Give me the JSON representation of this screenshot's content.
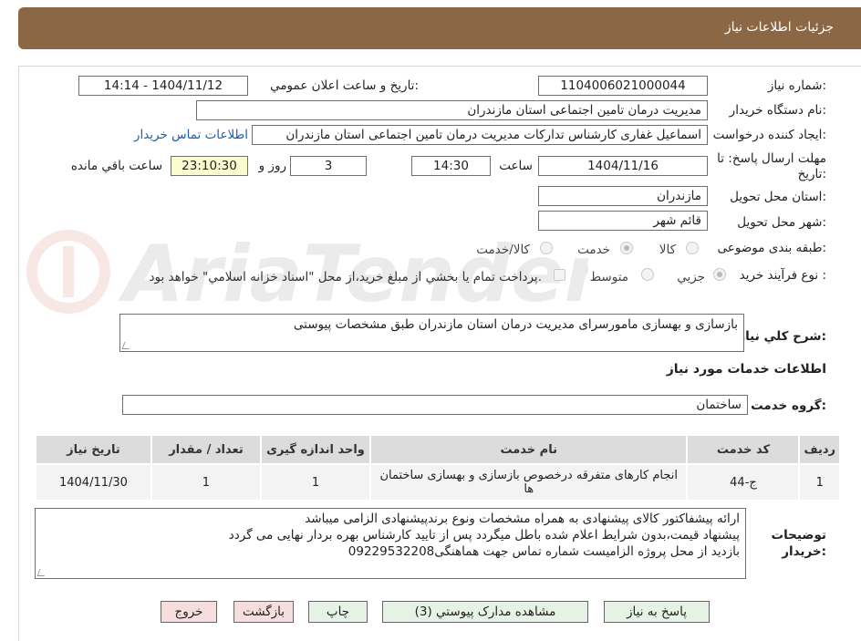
{
  "header": {
    "title": "جزئیات اطلاعات نیاز"
  },
  "form": {
    "need_number": {
      "label": "شماره نیاز:",
      "value": "1104006021000044"
    },
    "announce": {
      "label": "تاریخ و ساعت اعلان عمومي:",
      "value": "1404/11/12 - 14:14"
    },
    "buyer_org": {
      "label": "نام دستگاه خريدار:",
      "value": "مدیریت درمان تامین اجتماعی استان مازندران"
    },
    "requester": {
      "label": "ايجاد کننده درخواست:",
      "value": "اسماعیل غفاری کارشناس تداركات مدیریت درمان تامین اجتماعی استان مازندران",
      "contact_link": "اطلاعات تماس خريدار"
    },
    "deadline": {
      "label": "مهلت ارسال پاسخ: تا تاريخ:",
      "date": "1404/11/16",
      "time_label": "ساعت",
      "time": "14:30",
      "days": "3",
      "days_label": "روز و",
      "remaining": "23:10:30",
      "remaining_label": "ساعت باقي مانده"
    },
    "province": {
      "label": "استان محل تحويل:",
      "value": "مازندران"
    },
    "city": {
      "label": "شهر محل تحويل:",
      "value": "قائم شهر"
    },
    "category": {
      "label": "طبقه بندی موضوعی:",
      "options": [
        "کالا",
        "خدمت",
        "کالا/خدمت"
      ],
      "selected": "خدمت"
    },
    "process": {
      "label": "نوع فرآيند خريد :",
      "options": [
        "جزيي",
        "متوسط"
      ],
      "selected": "جزيي",
      "payment_note": "پرداخت تمام يا بخشي از مبلغ خريد،از محل \"اسناد خزانه اسلامي\" خواهد بود."
    },
    "general_desc": {
      "label": "شرح کلي نياز:",
      "value": "بازسازی و بهسازی مامورسرای مدیریت درمان استان مازندران طبق مشخصات پیوستی"
    },
    "services_title": "اطلاعات خدمات مورد نياز",
    "service_group": {
      "label": "گروه خدمت:",
      "value": "ساختمان"
    }
  },
  "table": {
    "headers": [
      "رديف",
      "کد خدمت",
      "نام خدمت",
      "واحد اندازه گيری",
      "تعداد / مقدار",
      "تاريخ نياز"
    ],
    "rows": [
      [
        "1",
        "ج-44",
        "انجام کارهای متفرقه درخصوص بازسازی و بهسازی ساختمان ها",
        "1",
        "1",
        "1404/11/30"
      ]
    ]
  },
  "buyer_notes": {
    "label": "توضيحات خريدار:",
    "lines": [
      "ارائه پیشفاکتور کالای پیشنهادی به همراه مشخصات ونوع برندپیشنهادی الزامی میباشد",
      "پیشنهاد قیمت،بدون شرایط اعلام شده باطل میگردد پس از تایید کارشناس بهره بردار نهایی می گردد",
      "بازدید از محل پروژه الزامیست شماره تماس جهت هماهنگی09229532208"
    ]
  },
  "buttons": {
    "reply": "پاسخ به نياز",
    "attachments": "مشاهده مدارک پيوستي (3)",
    "print": "چاپ",
    "back": "بازگشت",
    "exit": "خروج"
  },
  "watermark": "AriaTender.net",
  "colors": {
    "header": "#8b6746",
    "link": "#1a5fb4",
    "button_green": "#e6f2e6",
    "button_pink": "#f7dede",
    "highlight": "#fbfbd0"
  }
}
